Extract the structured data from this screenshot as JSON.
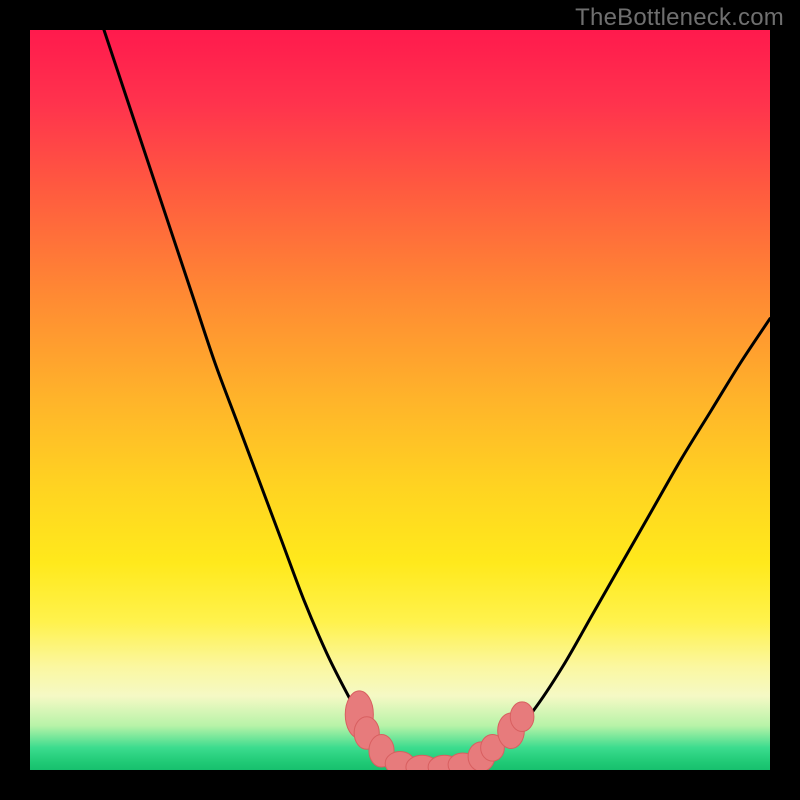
{
  "watermark": "TheBottleneck.com",
  "colors": {
    "background": "#000000",
    "curve": "#000000",
    "marker_fill": "#e77b7c",
    "marker_stroke": "#d85f60",
    "gradient_top": "#ff1a4d",
    "gradient_bottom": "#17c06e"
  },
  "chart_data": {
    "type": "line",
    "title": "",
    "xlabel": "",
    "ylabel": "",
    "xlim": [
      0,
      100
    ],
    "ylim": [
      0,
      100
    ],
    "series": [
      {
        "name": "bottleneck-curve",
        "x": [
          10,
          13,
          16,
          19,
          22,
          25,
          28,
          31,
          34,
          37,
          40,
          42.5,
          45,
          47.5,
          50,
          52.5,
          55,
          57.5,
          60,
          64,
          68,
          72,
          76,
          80,
          84,
          88,
          92,
          96,
          100
        ],
        "y": [
          100,
          91,
          82,
          73,
          64,
          55,
          47,
          39,
          31,
          23,
          16,
          11,
          6.5,
          3,
          0.8,
          0.2,
          0.2,
          0.5,
          1.2,
          3.5,
          8,
          14,
          21,
          28,
          35,
          42,
          48.5,
          55,
          61
        ]
      }
    ],
    "markers": [
      {
        "x": 44.5,
        "y": 7.5,
        "rx": 1.9,
        "ry": 3.2
      },
      {
        "x": 45.5,
        "y": 5.0,
        "rx": 1.7,
        "ry": 2.2
      },
      {
        "x": 47.5,
        "y": 2.6,
        "rx": 1.7,
        "ry": 2.2
      },
      {
        "x": 50.0,
        "y": 0.9,
        "rx": 2.0,
        "ry": 1.6
      },
      {
        "x": 53.0,
        "y": 0.4,
        "rx": 2.2,
        "ry": 1.6
      },
      {
        "x": 56.0,
        "y": 0.4,
        "rx": 2.2,
        "ry": 1.6
      },
      {
        "x": 58.5,
        "y": 0.7,
        "rx": 2.0,
        "ry": 1.6
      },
      {
        "x": 61.0,
        "y": 1.8,
        "rx": 1.8,
        "ry": 2.0
      },
      {
        "x": 62.5,
        "y": 3.0,
        "rx": 1.6,
        "ry": 1.8
      },
      {
        "x": 65.0,
        "y": 5.3,
        "rx": 1.8,
        "ry": 2.4
      },
      {
        "x": 66.5,
        "y": 7.2,
        "rx": 1.6,
        "ry": 2.0
      }
    ]
  }
}
